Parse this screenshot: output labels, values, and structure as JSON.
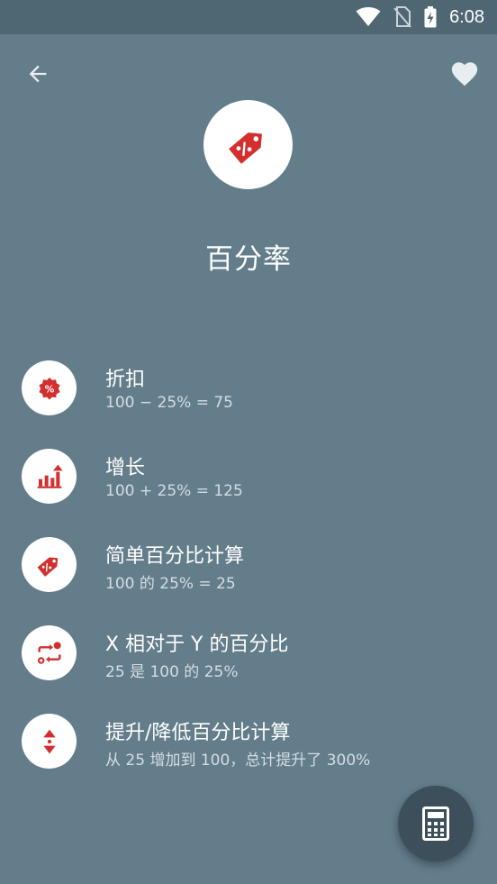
{
  "status_bar": {
    "time": "6:08",
    "icons": [
      "wifi-icon",
      "no-sim-icon",
      "battery-charging-icon"
    ]
  },
  "header": {
    "back_icon": "arrow-back-icon",
    "favorite_icon": "heart-icon",
    "hero_icon": "price-tag-percent-icon",
    "title": "百分率"
  },
  "items": [
    {
      "icon": "discount-badge-icon",
      "title": "折扣",
      "subtitle": "100 − 25% = 75"
    },
    {
      "icon": "growth-chart-icon",
      "title": "增长",
      "subtitle": "100 + 25% = 125"
    },
    {
      "icon": "price-tag-icon",
      "title": "简单百分比计算",
      "subtitle": "100 的 25% = 25"
    },
    {
      "icon": "relative-swap-icon",
      "title": "X 相对于 Y 的百分比",
      "subtitle": "25 是 100 的 25%"
    },
    {
      "icon": "up-down-icon",
      "title": "提升/降低百分比计算",
      "subtitle": "从 25 增加到 100，总计提升了 300%"
    }
  ],
  "fab": {
    "icon": "calculator-icon"
  },
  "colors": {
    "background": "#637d8b",
    "status_bar": "#4f6673",
    "accent_red": "#d32f2f",
    "fab": "#3c4f5a"
  }
}
